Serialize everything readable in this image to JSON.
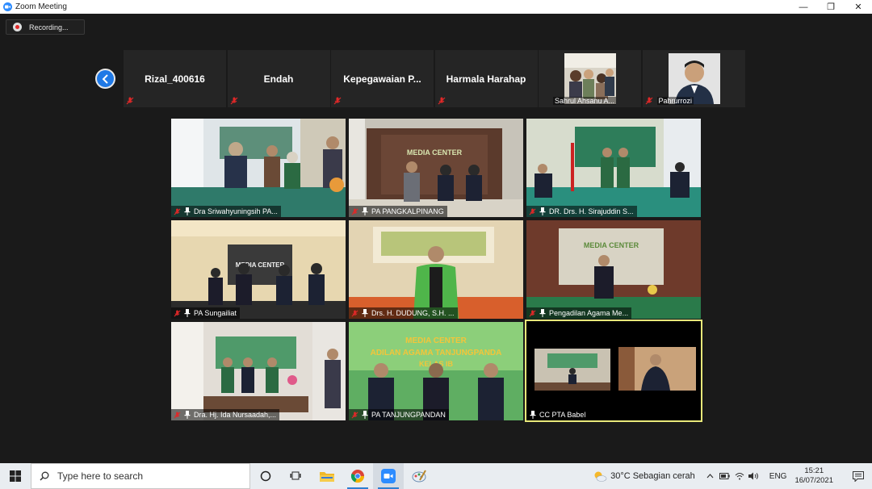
{
  "window": {
    "title": "Zoom Meeting",
    "minimize": "—",
    "maximize": "❐",
    "close": "✕"
  },
  "recording": {
    "label": "Recording..."
  },
  "strip": [
    {
      "name": "Rizal_400616",
      "video": false
    },
    {
      "name": "Endah",
      "video": false
    },
    {
      "name": "Kepegawaian  P...",
      "video": false
    },
    {
      "name": "Harmala Harahap",
      "video": false
    },
    {
      "name": "Sahrul Ahsanu A...",
      "video": true
    },
    {
      "name": "Pahrurrozi",
      "video": true
    }
  ],
  "gallery": [
    {
      "name": "Dra Sriwahyuningsih PA...",
      "muted": true
    },
    {
      "name": "PA PANGKALPINANG",
      "muted": true
    },
    {
      "name": "DR. Drs. H. Sirajuddin S...",
      "muted": true
    },
    {
      "name": "PA Sungailiat",
      "muted": true
    },
    {
      "name": "Drs. H. DUDUNG, S.H. ...",
      "muted": true
    },
    {
      "name": "Pengadilan Agama Me...",
      "muted": true
    },
    {
      "name": "Dra. Hj. Ida Nursaadah,...",
      "muted": true
    },
    {
      "name": "PA TANJUNGPANDAN",
      "muted": true
    },
    {
      "name": "CC PTA Babel",
      "muted": false,
      "active": true
    }
  ],
  "banners": {
    "media_center": "MEDIA CENTER",
    "tile8_line1": "MEDIA CENTER",
    "tile8_line2": "ADILAN AGAMA TANJUNGPANDA",
    "tile8_line3": "KELAS IB"
  },
  "taskbar": {
    "search_placeholder": "Type here to search",
    "weather": "30°C  Sebagian cerah",
    "lang": "ENG",
    "time": "15:21",
    "date": "16/07/2021"
  },
  "colors": {
    "zoom_blue": "#2d8cff",
    "active_border": "#e8e87a",
    "mute_red": "#e02828"
  }
}
